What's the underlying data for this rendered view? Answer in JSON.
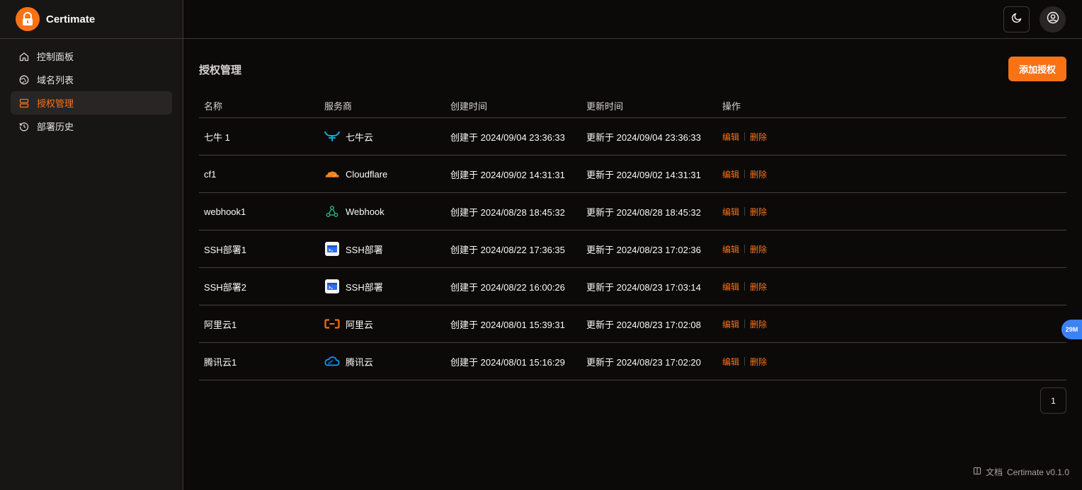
{
  "app": {
    "name": "Certimate"
  },
  "sidebar": {
    "items": [
      {
        "label": "控制面板",
        "icon": "home-icon",
        "active": false
      },
      {
        "label": "域名列表",
        "icon": "globe-icon",
        "active": false
      },
      {
        "label": "授权管理",
        "icon": "server-icon",
        "active": true
      },
      {
        "label": "部署历史",
        "icon": "history-icon",
        "active": false
      }
    ]
  },
  "header": {
    "theme_icon": "moon-icon",
    "user_icon": "user-circle-icon"
  },
  "page": {
    "title": "授权管理",
    "add_button": "添加授权"
  },
  "table": {
    "headers": {
      "name": "名称",
      "provider": "服务商",
      "created": "创建时间",
      "updated": "更新时间",
      "actions": "操作"
    },
    "actions": {
      "edit": "编辑",
      "delete": "删除"
    },
    "rows": [
      {
        "name": "七牛 1",
        "provider": "七牛云",
        "provider_icon": "qiniu-icon",
        "created": "创建于 2024/09/04 23:36:33",
        "updated": "更新于 2024/09/04 23:36:33"
      },
      {
        "name": "cf1",
        "provider": "Cloudflare",
        "provider_icon": "cloudflare-icon",
        "created": "创建于 2024/09/02 14:31:31",
        "updated": "更新于 2024/09/02 14:31:31"
      },
      {
        "name": "webhook1",
        "provider": "Webhook",
        "provider_icon": "webhook-icon",
        "created": "创建于 2024/08/28 18:45:32",
        "updated": "更新于 2024/08/28 18:45:32"
      },
      {
        "name": "SSH部署1",
        "provider": "SSH部署",
        "provider_icon": "ssh-icon",
        "created": "创建于 2024/08/22 17:36:35",
        "updated": "更新于 2024/08/23 17:02:36"
      },
      {
        "name": "SSH部署2",
        "provider": "SSH部署",
        "provider_icon": "ssh-icon",
        "created": "创建于 2024/08/22 16:00:26",
        "updated": "更新于 2024/08/23 17:03:14"
      },
      {
        "name": "阿里云1",
        "provider": "阿里云",
        "provider_icon": "aliyun-icon",
        "created": "创建于 2024/08/01 15:39:31",
        "updated": "更新于 2024/08/23 17:02:08"
      },
      {
        "name": "腾讯云1",
        "provider": "腾讯云",
        "provider_icon": "tencent-cloud-icon",
        "created": "创建于 2024/08/01 15:16:29",
        "updated": "更新于 2024/08/23 17:02:20"
      }
    ]
  },
  "pagination": {
    "current": "1"
  },
  "float_badge": "29M",
  "footer": {
    "docs": "文档",
    "version": "Certimate v0.1.0"
  },
  "colors": {
    "accent": "#f97316",
    "background": "#0c0a09",
    "sidebar": "#181614",
    "border": "#44403c"
  }
}
